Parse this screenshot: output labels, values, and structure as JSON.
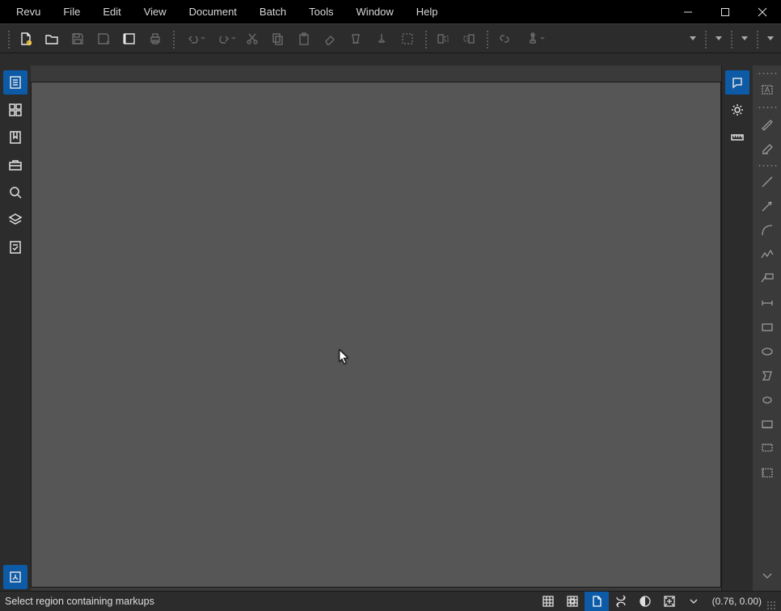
{
  "menu": {
    "items": [
      "Revu",
      "File",
      "Edit",
      "View",
      "Document",
      "Batch",
      "Tools",
      "Window",
      "Help"
    ]
  },
  "toolbar": {
    "items": [
      {
        "name": "new-file",
        "enabled": true
      },
      {
        "name": "open-file",
        "enabled": true
      },
      {
        "name": "save",
        "enabled": false
      },
      {
        "name": "save-as",
        "enabled": false
      },
      {
        "name": "tab-access",
        "enabled": true
      },
      {
        "name": "print",
        "enabled": false
      }
    ],
    "items2": [
      {
        "name": "undo",
        "drop": true
      },
      {
        "name": "redo",
        "drop": true
      },
      {
        "name": "cut"
      },
      {
        "name": "copy"
      },
      {
        "name": "paste"
      },
      {
        "name": "eraser"
      },
      {
        "name": "highlight"
      },
      {
        "name": "callout"
      },
      {
        "name": "select-region"
      }
    ],
    "items3": [
      {
        "name": "align-left"
      },
      {
        "name": "align-right"
      }
    ],
    "items4": [
      {
        "name": "link"
      },
      {
        "name": "stamp",
        "drop": true
      }
    ]
  },
  "left_panel": {
    "items": [
      {
        "name": "file-access",
        "active": true
      },
      {
        "name": "thumbnails",
        "active": false
      },
      {
        "name": "bookmarks",
        "active": false
      },
      {
        "name": "tool-chest",
        "active": false
      },
      {
        "name": "search",
        "active": false
      },
      {
        "name": "layers",
        "active": false
      },
      {
        "name": "forms",
        "active": false
      }
    ],
    "bottom": {
      "name": "studio",
      "active": true
    }
  },
  "right_panel": {
    "items": [
      {
        "name": "properties",
        "active": true
      },
      {
        "name": "settings",
        "active": false
      },
      {
        "name": "measurements",
        "active": false
      }
    ]
  },
  "right_tools": {
    "items": [
      {
        "name": "text-box",
        "sep_after": true
      },
      {
        "name": "pen"
      },
      {
        "name": "highlighter",
        "sep_after": true
      },
      {
        "name": "line"
      },
      {
        "name": "arrow"
      },
      {
        "name": "arc"
      },
      {
        "name": "polyline"
      },
      {
        "name": "callout"
      },
      {
        "name": "dimension"
      },
      {
        "name": "rectangle"
      },
      {
        "name": "ellipse"
      },
      {
        "name": "polygon"
      },
      {
        "name": "cloud"
      },
      {
        "name": "cloud-plus"
      },
      {
        "name": "measure-count"
      },
      {
        "name": "measure-area"
      }
    ],
    "more": "more"
  },
  "status": {
    "message": "Select region containing markups",
    "items": [
      {
        "name": "grid"
      },
      {
        "name": "snap"
      },
      {
        "name": "page-layout",
        "active": true
      },
      {
        "name": "sync-view"
      },
      {
        "name": "dim"
      },
      {
        "name": "fit"
      },
      {
        "name": "fit-dropdown"
      }
    ],
    "coords": "(0.76, 0.00)"
  }
}
